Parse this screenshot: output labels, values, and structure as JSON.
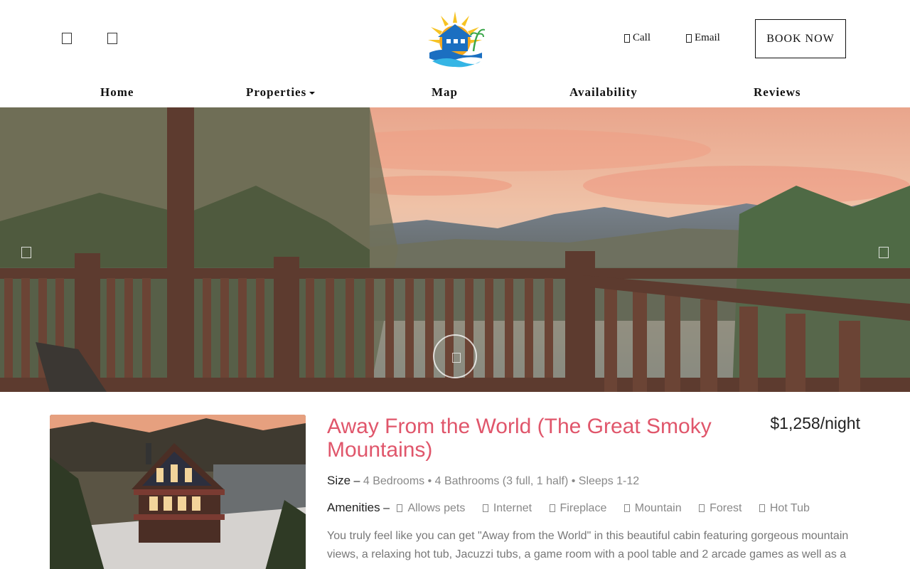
{
  "header": {
    "social_icons": [
      "facebook-icon",
      "instagram-icon"
    ],
    "logo_icon": "beach-house-logo",
    "call_label": "Call",
    "email_label": "Email",
    "book_label": "BOOK NOW"
  },
  "nav": {
    "items": [
      {
        "label": "Home"
      },
      {
        "label": "Properties"
      },
      {
        "label": "Map"
      },
      {
        "label": "Availability"
      },
      {
        "label": "Reviews"
      }
    ]
  },
  "hero": {
    "prev_icon": "chevron-left-icon",
    "next_icon": "chevron-right-icon",
    "play_icon": "play-icon"
  },
  "listing": {
    "title": "Away From the World (The Great Smoky Mountains)",
    "price": "$1,258/night",
    "size_label": "Size",
    "size_value": "4 Bedrooms • 4 Bathrooms (3 full, 1 half) • Sleeps 1-12",
    "amenities_label": "Amenities",
    "amenities": [
      "Allows pets",
      "Internet",
      "Fireplace",
      "Mountain",
      "Forest",
      "Hot Tub"
    ],
    "description": "You truly feel like you can get \"Away from the World\" in this beautiful cabin featuring gorgeous mountain views, a relaxing hot tub, Jacuzzi tubs, a game room with a pool table and 2 arcade games as well as a"
  },
  "colors": {
    "title": "#e0566b",
    "text": "#222222",
    "muted": "#888888"
  }
}
